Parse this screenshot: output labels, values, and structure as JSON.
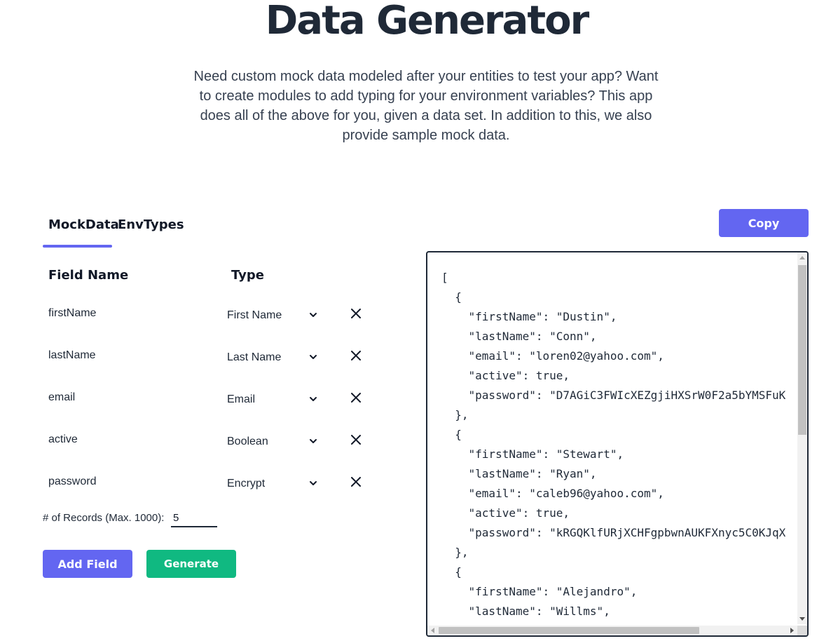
{
  "header": {
    "title": "Data Generator",
    "intro": "Need custom mock data modeled after your entities to test your app? Want to create modules to add typing for your environment variables? This app does all of the above for you, given a data set. In addition to this, we also provide sample mock data."
  },
  "tabs": [
    {
      "label": "MockData",
      "active": true
    },
    {
      "label": "EnvTypes",
      "active": false
    }
  ],
  "table": {
    "field_name_header": "Field Name",
    "type_header": "Type",
    "rows": [
      {
        "name": "firstName",
        "type": "First Name"
      },
      {
        "name": "lastName",
        "type": "Last Name"
      },
      {
        "name": "email",
        "type": "Email"
      },
      {
        "name": "active",
        "type": "Boolean"
      },
      {
        "name": "password",
        "type": "Encrypt"
      }
    ]
  },
  "records": {
    "label": "# of Records (Max. 1000):",
    "value": "5"
  },
  "buttons": {
    "add_field": "Add Field",
    "generate": "Generate",
    "copy": "Copy"
  },
  "output": {
    "text": "[\n  {\n    \"firstName\": \"Dustin\",\n    \"lastName\": \"Conn\",\n    \"email\": \"loren02@yahoo.com\",\n    \"active\": true,\n    \"password\": \"D7AGiC3FWIcXEZgjiHXSrW0F2a5bYMSFuK\n  },\n  {\n    \"firstName\": \"Stewart\",\n    \"lastName\": \"Ryan\",\n    \"email\": \"caleb96@yahoo.com\",\n    \"active\": true,\n    \"password\": \"kRGQKlfURjXCHFgpbwnAUKFXnyc5C0KJqX\n  },\n  {\n    \"firstName\": \"Alejandro\",\n    \"lastName\": \"Willms\","
  },
  "colors": {
    "primary": "#6366f1",
    "generate": "#10b981",
    "text": "#1f2937"
  },
  "icons": {
    "select": "chevron-down-icon",
    "delete": "close-icon"
  }
}
